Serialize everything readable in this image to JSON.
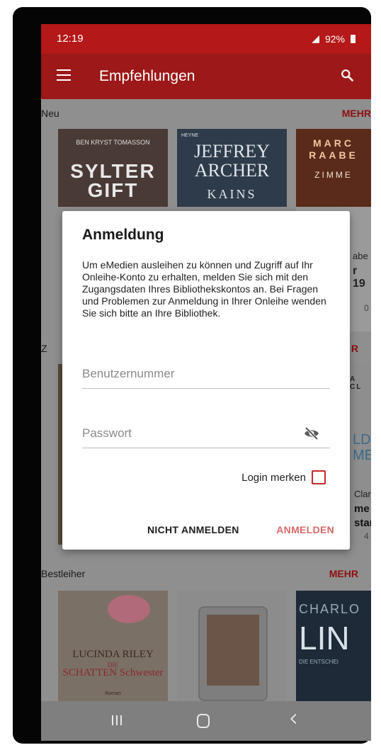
{
  "status": {
    "time": "12:19",
    "battery": "92%"
  },
  "appbar": {
    "title": "Empfehlungen"
  },
  "sections": {
    "neu": {
      "label": "Neu",
      "more": "MEHR"
    },
    "z": {
      "label": "Z",
      "more": "R"
    },
    "bestleiher": {
      "label": "Bestleiher",
      "more": "MEHR"
    }
  },
  "covers": {
    "c1": {
      "author": "BEN KRYST TOMASSON",
      "title": "SYLTER GIFT"
    },
    "c2": {
      "publisher": "HEYNE",
      "author": "JEFFREY ARCHER",
      "title": "KAINS"
    },
    "c3": {
      "author": "MARC RAABE",
      "title": "ZIMME"
    },
    "c3_peek": {
      "line1": "abe",
      "line2": "r 19",
      "line3": "0"
    },
    "c4_peek": {
      "line1": "A CL",
      "line2": "LD",
      "line3": "ME",
      "line4": "Clar",
      "line5": "me",
      "line6": "star",
      "line7": "4"
    },
    "b1": {
      "author": "LUCINDA RILEY",
      "title_small": "DIE",
      "title": "SCHATTEN Schwester",
      "sub": "Roman"
    },
    "b3": {
      "author": "CHARLO",
      "title": "LIN",
      "sub": "DIE ENTSCHEI"
    }
  },
  "dialog": {
    "title": "Anmeldung",
    "message": "Um eMedien ausleihen zu können und Zugriff auf Ihr Onleihe-Konto zu erhalten, melden Sie sich mit den Zugangsdaten Ihres Bibliothekskontos an. Bei Fragen und Problemen zur Anmeldung in Ihrer Onleihe wenden Sie sich bitte an Ihre Bibliothek.",
    "username_placeholder": "Benutzernummer",
    "password_placeholder": "Passwort",
    "remember_label": "Login merken",
    "cancel_label": "NICHT ANMELDEN",
    "login_label": "ANMELDEN"
  },
  "colors": {
    "primary": "#b41818",
    "appbar": "#9d1818",
    "accent": "#c62828"
  },
  "icons": [
    "menu-icon",
    "search-icon",
    "eye-off-icon",
    "checkbox-icon",
    "nav-recent-icon",
    "nav-home-icon",
    "nav-back-icon"
  ]
}
